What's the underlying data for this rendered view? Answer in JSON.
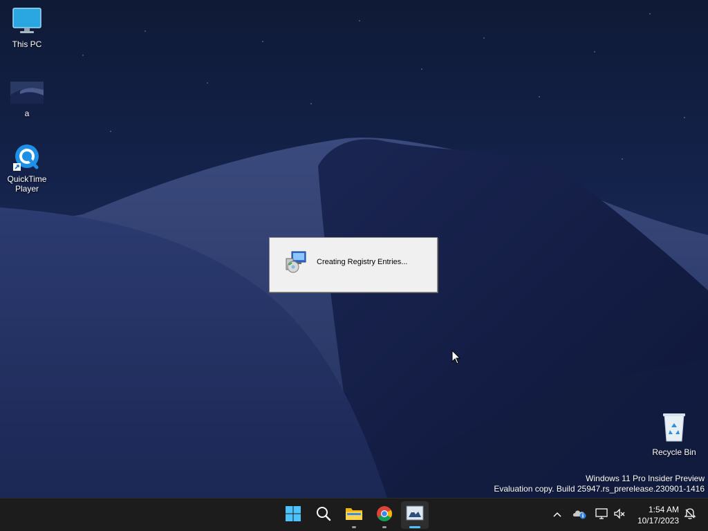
{
  "desktop": {
    "icons": [
      {
        "label": "This PC",
        "icon": "monitor-icon"
      },
      {
        "label": "a",
        "icon": "image-thumbnail-icon"
      },
      {
        "label": "QuickTime Player",
        "icon": "quicktime-icon"
      },
      {
        "label": "Recycle Bin",
        "icon": "recycle-bin-icon"
      }
    ]
  },
  "dialog": {
    "message": "Creating Registry Entries...",
    "icon": "installer-icon"
  },
  "watermark": {
    "line1": "Windows 11 Pro Insider Preview",
    "line2": "Evaluation copy. Build 25947.rs_prerelease.230901-1416"
  },
  "taskbar": {
    "apps": [
      {
        "name": "Start",
        "icon": "windows-start-icon"
      },
      {
        "name": "Search",
        "icon": "search-icon"
      },
      {
        "name": "File Explorer",
        "icon": "folder-icon"
      },
      {
        "name": "Google Chrome",
        "icon": "chrome-icon"
      },
      {
        "name": "Installer",
        "icon": "installer-app-icon"
      }
    ],
    "tray": {
      "icons": [
        "chevron-up-icon",
        "onedrive-icon",
        "network-icon",
        "volume-muted-icon",
        "notification-icon"
      ]
    },
    "clock": {
      "time": "1:54 AM",
      "date": "10/17/2023"
    }
  },
  "colors": {
    "accent": "#4cc2ff",
    "taskbar": "#1c1c1c",
    "dialog_bg": "#f0f0f0"
  }
}
